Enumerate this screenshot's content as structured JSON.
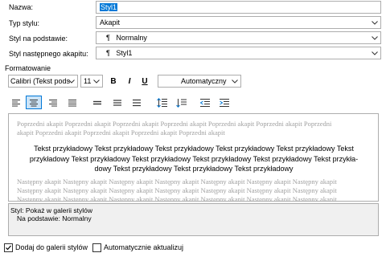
{
  "fields": {
    "name": {
      "label": "Nazwa:",
      "value": "Styl1"
    },
    "style_type": {
      "label": "Typ stylu:",
      "value": "Akapit"
    },
    "based_on": {
      "label": "Styl na podstawie:",
      "value": "Normalny",
      "icon": "paragraph-mark-icon"
    },
    "next_style": {
      "label": "Styl następnego akapitu:",
      "value": "Styl1",
      "icon": "paragraph-mark-icon"
    }
  },
  "formatting": {
    "title": "Formatowanie",
    "font": "Calibri (Tekst pods",
    "size": "11",
    "bold": "B",
    "italic": "I",
    "underline": "U",
    "color": "Automatyczny"
  },
  "preview": {
    "previous_lines": [
      "Poprzedni akapit Poprzedni akapit Poprzedni akapit Poprzedni akapit Poprzedni akapit Poprzedni akapit Poprzedni",
      "akapit Poprzedni akapit Poprzedni akapit Poprzedni akapit Poprzedni akapit"
    ],
    "sample_lines": [
      "Tekst przykładowy Tekst przykładowy Tekst przykładowy Tekst przykładowy Tekst przykładowy Tekst",
      "przykładowy Tekst przykładowy Tekst przykładowy Tekst przykładowy Tekst przykładowy Tekst przykła-",
      "dowy Tekst przykładowy Tekst przykładowy Tekst przykładowy"
    ],
    "next_lines": [
      "Następny akapit Następny akapit Następny akapit Następny akapit Następny akapit Następny akapit Następny akapit",
      "Następny akapit Następny akapit Następny akapit Następny akapit Następny akapit Następny akapit Następny akapit",
      "Następny akapit Następny akapit Następny akapit Następny akapit Następny akapit Następny akapit Następny akapit",
      "Następny akapit Następny akapit Następny akapit Następny akapit Następny akapit Następny akapit Następny akapit"
    ]
  },
  "description": {
    "line1": "Styl: Pokaż w galerii stylów",
    "line2": "Na podstawie: Normalny"
  },
  "options": {
    "add_to_gallery": {
      "label": "Dodaj do galerii stylów",
      "checked": true
    },
    "auto_update": {
      "label": "Automatycznie aktualizuj",
      "checked": false
    }
  },
  "colors": {
    "accent": "#0078d7",
    "active_bg": "#cce4f7"
  }
}
